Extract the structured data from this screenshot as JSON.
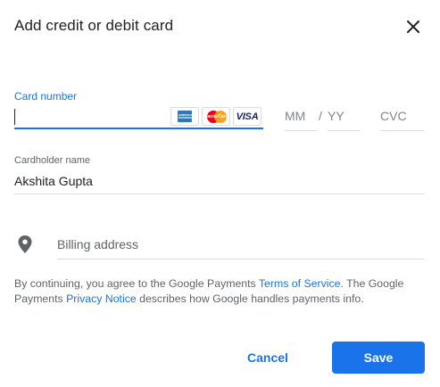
{
  "dialog": {
    "title": "Add credit or debit card",
    "close_icon": "close-icon"
  },
  "card_number": {
    "label": "Card number",
    "value": "",
    "logos": [
      {
        "name": "amex-logo",
        "text": "AMERICAN EXPRESS"
      },
      {
        "name": "mastercard-logo",
        "text": "MasterCard"
      },
      {
        "name": "visa-logo",
        "text": "VISA"
      }
    ]
  },
  "expiry": {
    "month_placeholder": "MM",
    "separator": "/",
    "year_placeholder": "YY"
  },
  "cvc": {
    "placeholder": "CVC"
  },
  "cardholder": {
    "label": "Cardholder name",
    "value": "Akshita Gupta"
  },
  "billing": {
    "icon": "location-pin-icon",
    "placeholder": "Billing address"
  },
  "legal": {
    "part1": "By continuing, you agree to the Google Payments ",
    "terms_link": "Terms of Service",
    "part2": ". The Google Payments ",
    "privacy_link": "Privacy Notice",
    "part3": " describes how Google handles payments info."
  },
  "buttons": {
    "cancel": "Cancel",
    "save": "Save"
  },
  "colors": {
    "accent": "#1a73e8",
    "text": "#202124",
    "muted": "#5f6368",
    "divider": "#dadce0"
  }
}
